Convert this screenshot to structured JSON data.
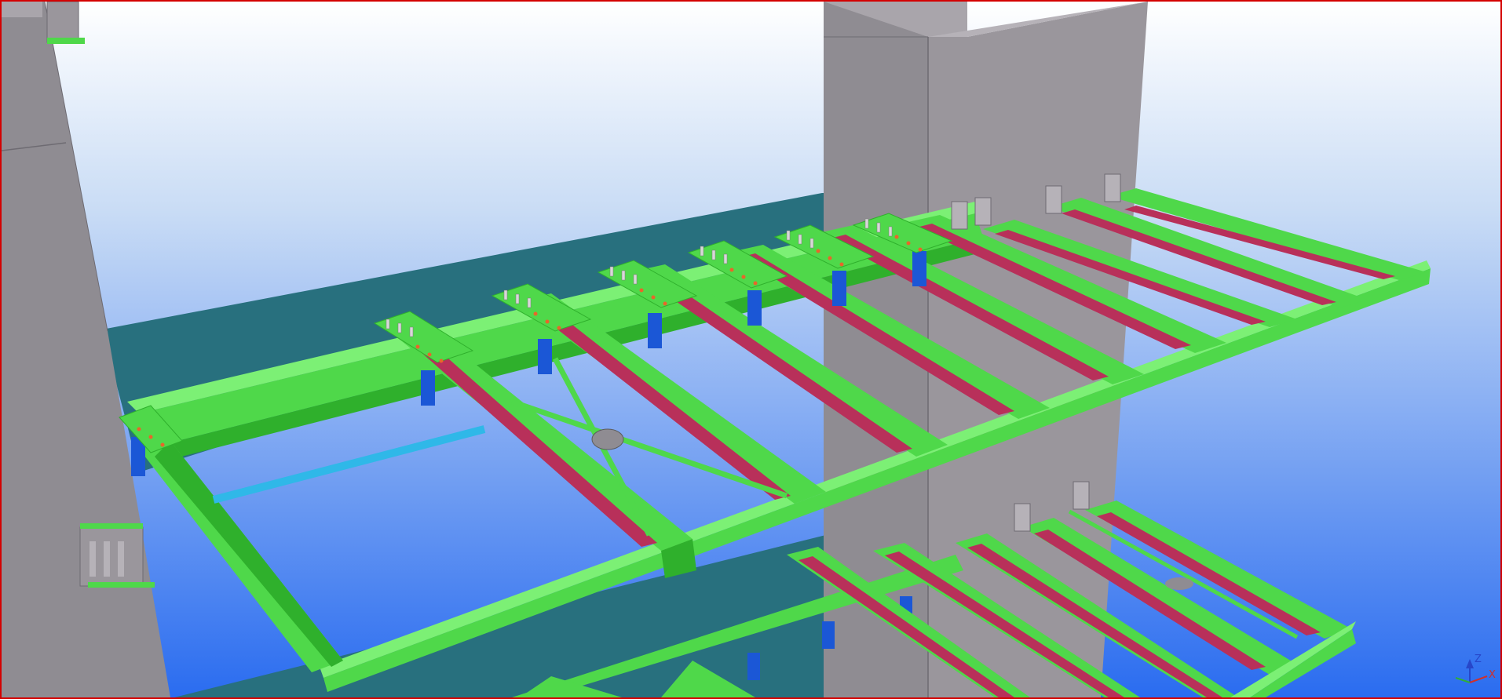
{
  "viewport": {
    "background_top": "#ffffff",
    "background_bottom": "#2a6cf0",
    "border_color": "#d40000"
  },
  "colors": {
    "steel_green": "#4fd84a",
    "steel_green_dark": "#2fb02c",
    "steel_green_light": "#7cf075",
    "concrete": "#8f8c92",
    "concrete_light": "#a9a5ab",
    "concrete_dark": "#6e6b72",
    "slab_teal": "#28707e",
    "weld_red": "#b8305a",
    "plate_blue": "#1b57d6",
    "bolt_orange": "#e8662a",
    "bolt_white": "#d8d8d8",
    "bracing_cyan": "#2fb8e8"
  },
  "axis_indicator": {
    "z_label": "Z",
    "x_label": "X",
    "z_color": "#2746c9",
    "x_color": "#d0302a",
    "y_color": "#2fae3a"
  }
}
